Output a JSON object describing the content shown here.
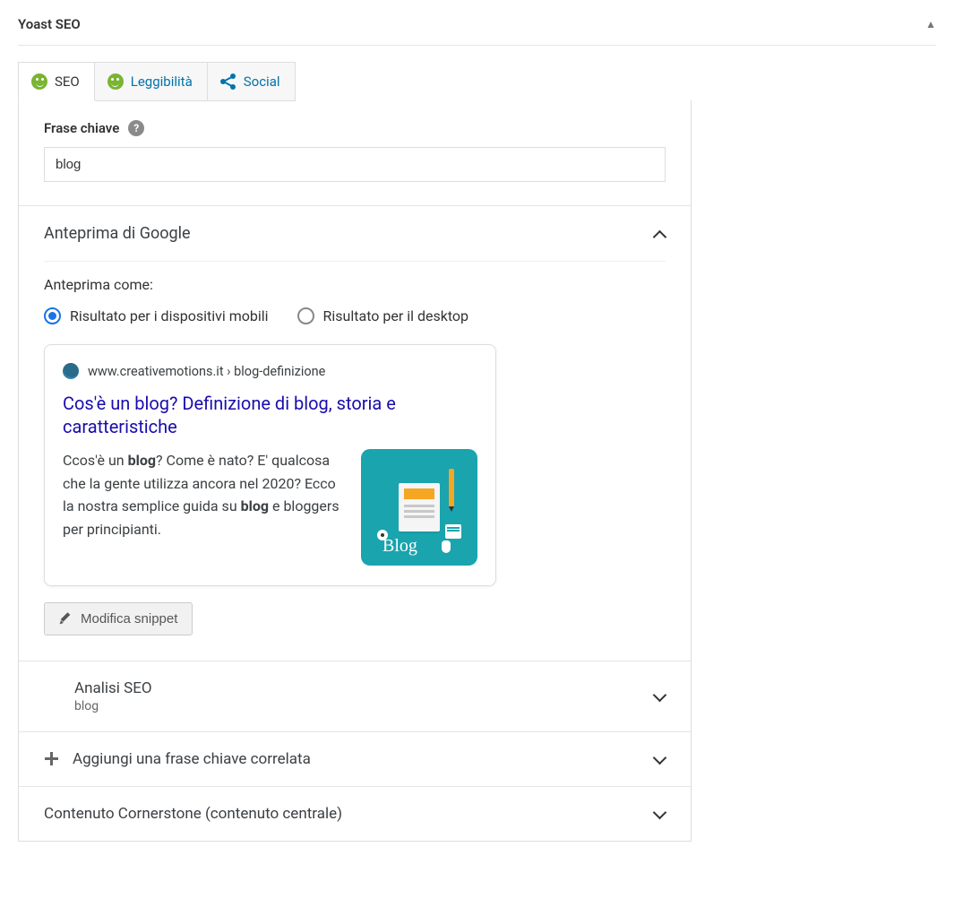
{
  "panel": {
    "title": "Yoast SEO"
  },
  "tabs": {
    "seo": "SEO",
    "readability": "Leggibilità",
    "social": "Social"
  },
  "focus": {
    "label": "Frase chiave",
    "value": "blog"
  },
  "google_preview": {
    "header": "Anteprima di Google",
    "preview_as_label": "Anteprima come:",
    "radio_mobile": "Risultato per i dispositivi mobili",
    "radio_desktop": "Risultato per il desktop",
    "breadcrumb": "www.creativemotions.it › blog-definizione",
    "title": "Cos'è un blog? Definizione di blog, storia e caratteristiche",
    "desc_pre": "Ccos'è un ",
    "desc_kw1": "blog",
    "desc_mid": "? Come è nato? E' qualcosa che la gente utilizza ancora nel 2020? Ecco la nostra semplice guida su ",
    "desc_kw2": "blog",
    "desc_post": " e bloggers per principianti.",
    "thumb_label": "Blog",
    "edit_snippet": "Modifica snippet"
  },
  "sections": {
    "analysis_title": "Analisi SEO",
    "analysis_sub": "blog",
    "related_title": "Aggiungi una frase chiave correlata",
    "cornerstone_title": "Contenuto Cornerstone (contenuto centrale)"
  }
}
